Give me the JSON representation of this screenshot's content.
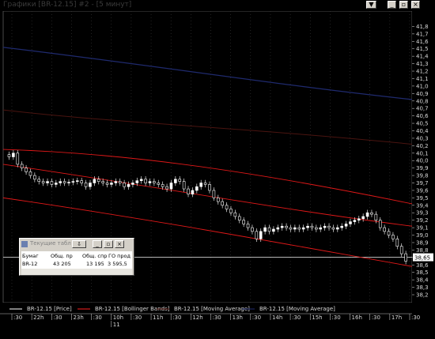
{
  "window": {
    "title": "Графики [BR-12.15] #2 - [5 минут]",
    "controls": [
      "minimize-button",
      "restore-button",
      "close-button"
    ]
  },
  "chart_data": {
    "type": "candlestick",
    "instrument": "BR-12.15",
    "timeframe": "5 минут",
    "ylim": [
      38.2,
      41.9
    ],
    "yticks": [
      "41,8",
      "41,7",
      "41,6",
      "41,5",
      "41,4",
      "41,3",
      "41,2",
      "41,1",
      "41,0",
      "40,9",
      "40,8",
      "40,7",
      "40,6",
      "40,5",
      "40,4",
      "40,3",
      "40,2",
      "40,1",
      "40,0",
      "39,9",
      "39,8",
      "39,7",
      "39,6",
      "39,5",
      "39,4",
      "39,3",
      "39,2",
      "39,1",
      "39,0",
      "38,9",
      "38,8",
      "38,7",
      "38,6",
      "38,5",
      "38,4",
      "38,3",
      "38,2"
    ],
    "current_price_label": "38,65",
    "x_row1": [
      ":30",
      "22h",
      ":30",
      "23h",
      ":30",
      "10h",
      ":30",
      "11h",
      ":30",
      "12h",
      ":30",
      "13h",
      ":30",
      "14h",
      ":30",
      "15h",
      ":30",
      "16h",
      ":30",
      "17h",
      ":30"
    ],
    "x_row2_label": "11",
    "close_series": [
      40.05,
      40.1,
      39.95,
      39.9,
      39.85,
      39.8,
      39.75,
      39.72,
      39.7,
      39.72,
      39.68,
      39.7,
      39.72,
      39.7,
      39.71,
      39.72,
      39.73,
      39.7,
      39.65,
      39.7,
      39.75,
      39.72,
      39.7,
      39.68,
      39.7,
      39.72,
      39.7,
      39.65,
      39.68,
      39.7,
      39.73,
      39.75,
      39.7,
      39.72,
      39.7,
      39.68,
      39.65,
      39.62,
      39.7,
      39.75,
      39.72,
      39.62,
      39.55,
      39.6,
      39.65,
      39.7,
      39.68,
      39.6,
      39.5,
      39.45,
      39.4,
      39.35,
      39.3,
      39.25,
      39.2,
      39.15,
      39.1,
      39.05,
      38.95,
      39.05,
      39.1,
      39.05,
      39.08,
      39.1,
      39.12,
      39.1,
      39.08,
      39.1,
      39.08,
      39.1,
      39.12,
      39.1,
      39.08,
      39.1,
      39.12,
      39.1,
      39.08,
      39.1,
      39.12,
      39.15,
      39.18,
      39.2,
      39.22,
      39.25,
      39.3,
      39.28,
      39.2,
      39.1,
      39.05,
      39.0,
      38.95,
      38.85,
      38.75,
      38.65
    ],
    "series": [
      {
        "name": "BR-12.15 [Price]",
        "color": "#ffffff"
      },
      {
        "name": "BR-12.15 [Bollinger Bands]",
        "color": "#ff2020"
      },
      {
        "name": "BR-12.15 [Moving Average]",
        "color": "#5a1a14"
      },
      {
        "name": "BR-12.15 [Moving Average]",
        "color": "#1f2a6e"
      }
    ]
  },
  "table": {
    "title": "Текущие табл",
    "headers": [
      "Бумаг",
      "Общ. пр",
      "Общ. спр",
      "ГО прод"
    ],
    "row": [
      "BR-12",
      "43 205",
      "13 195",
      "3 595,5"
    ]
  }
}
